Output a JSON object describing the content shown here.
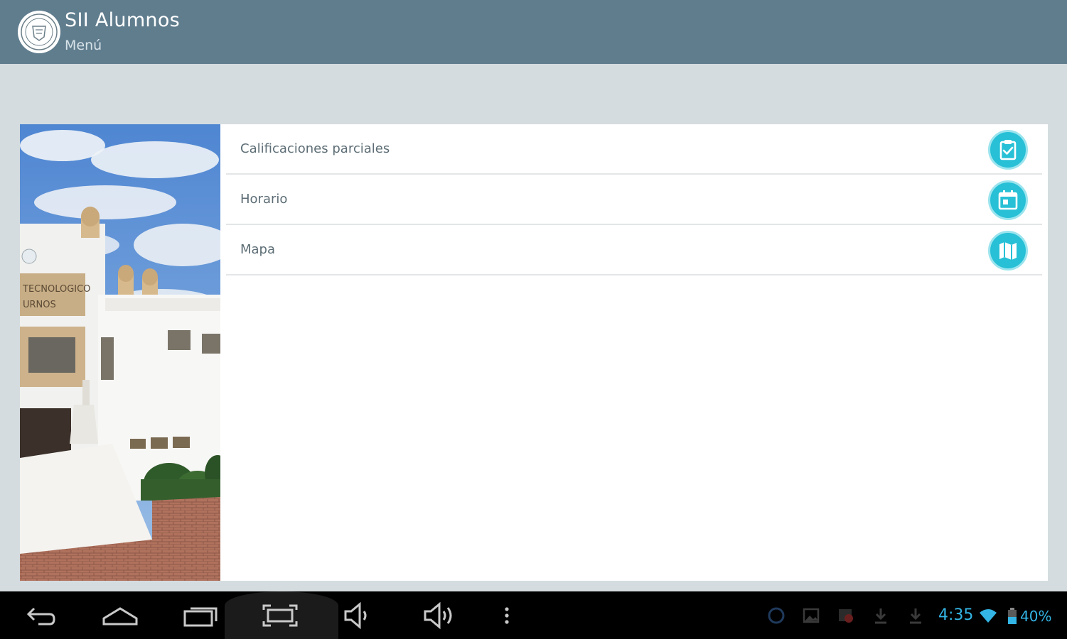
{
  "app": {
    "title": "SII Alumnos",
    "subtitle": "Menú",
    "logo_icon": "school-seal-logo"
  },
  "menu": {
    "items": [
      {
        "label": "Calificaciones parciales",
        "icon": "clipboard-check-icon"
      },
      {
        "label": "Horario",
        "icon": "calendar-icon"
      },
      {
        "label": "Mapa",
        "icon": "map-icon"
      }
    ]
  },
  "colors": {
    "appbar": "#607d8e",
    "background": "#d4dcdf",
    "accent": "#27c0d6",
    "status_blue": "#33b5e5"
  },
  "navbar": {
    "buttons": [
      "back-icon",
      "home-icon",
      "recent-apps-icon",
      "screenshot-icon",
      "volume-down-icon",
      "volume-up-icon",
      "overflow-menu-icon"
    ]
  },
  "statusbar": {
    "time": "4:35",
    "battery": "40%",
    "icons": [
      "notification-icon",
      "gallery-icon",
      "app-update-icon",
      "download-icon",
      "download-icon",
      "wifi-icon",
      "battery-icon"
    ]
  }
}
